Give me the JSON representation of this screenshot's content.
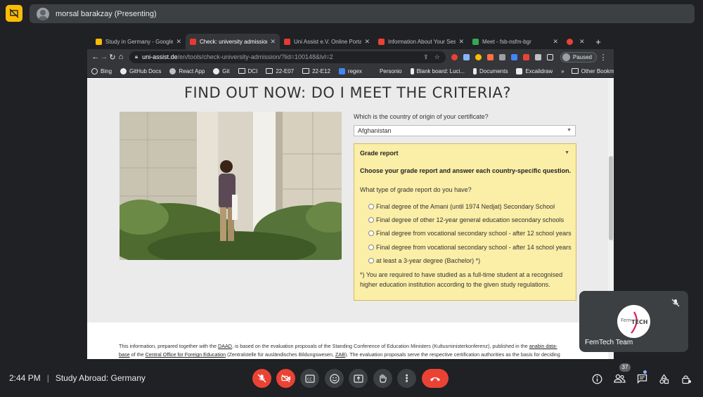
{
  "meet": {
    "presenter_label": "morsal barakzay (Presenting)",
    "time": "2:44 PM",
    "separator": "|",
    "meeting_title": "Study Abroad: Germany",
    "participant_count": "37"
  },
  "browser": {
    "tabs": [
      {
        "title": "Study in Germany - Google S",
        "color": "#fbbc04"
      },
      {
        "title": "Check: university admission",
        "color": "#e53935"
      },
      {
        "title": "Uni Assist e.V. Online Portal",
        "color": "#e53935"
      },
      {
        "title": "Information About Your Sess",
        "color": "#ea4335"
      },
      {
        "title": "Meet - fsb-nsfm-bgr",
        "color": "#34a853"
      },
      {
        "title": "",
        "color": "#ea4335"
      }
    ],
    "url_host": "uni-assist.de",
    "url_path": "/en/tools/check-university-admission/?lid=100148&lvl=2",
    "profile_status": "Paused",
    "bookmarks": [
      "Bing",
      "GitHub Docs",
      "React App",
      "Git",
      "DCI",
      "22-E07",
      "22-E12",
      "regex",
      "Personio",
      "Blank board: Luci...",
      "Documents",
      "Excalidraw"
    ],
    "other_bookmarks": "Other Bookmarks"
  },
  "page": {
    "headline": "FIND OUT NOW: DO I MEET THE CRITERIA?",
    "country_question": "Which is the country of origin of your certificate?",
    "country_value": "Afghanistan",
    "grade_title": "Grade report",
    "grade_instruction": "Choose your grade report and answer each country-specific question.",
    "grade_question": "What type of grade report do you have?",
    "options": [
      "Final degree of the Amani (until 1974 Nedjat) Secondary School",
      "Final degree of other 12-year general education secondary schools",
      "Final degree from vocational secondary school - after 12 school years",
      "Final degree from vocational secondary school - after 14 school years",
      "at least a 3-year degree (Bachelor) *)"
    ],
    "note": "*) You are required to have studied as a full-time student at a recognised higher education institution according to the given study regulations.",
    "footer": {
      "t1": "This information, prepared together with the ",
      "daad": "DAAD",
      "t2": ", is based on the evaluation proposals of the Standing Conference of Education Ministers (Kultusministerkonferenz), published in the ",
      "anabin1": "anabin data-",
      "anabin2": "base",
      "t3": " of the ",
      "central": "Central Office for Foreign Education",
      "t4": " (Zentralstelle für ausländisches Bildungswesen, ",
      "zab": "ZAB",
      "t5": "). The evaluation proposals serve the respective certification authorities as the basis for deciding"
    }
  },
  "tile": {
    "name": "FemTech Team",
    "logo_a": "Fem",
    "logo_b": "TECH"
  }
}
